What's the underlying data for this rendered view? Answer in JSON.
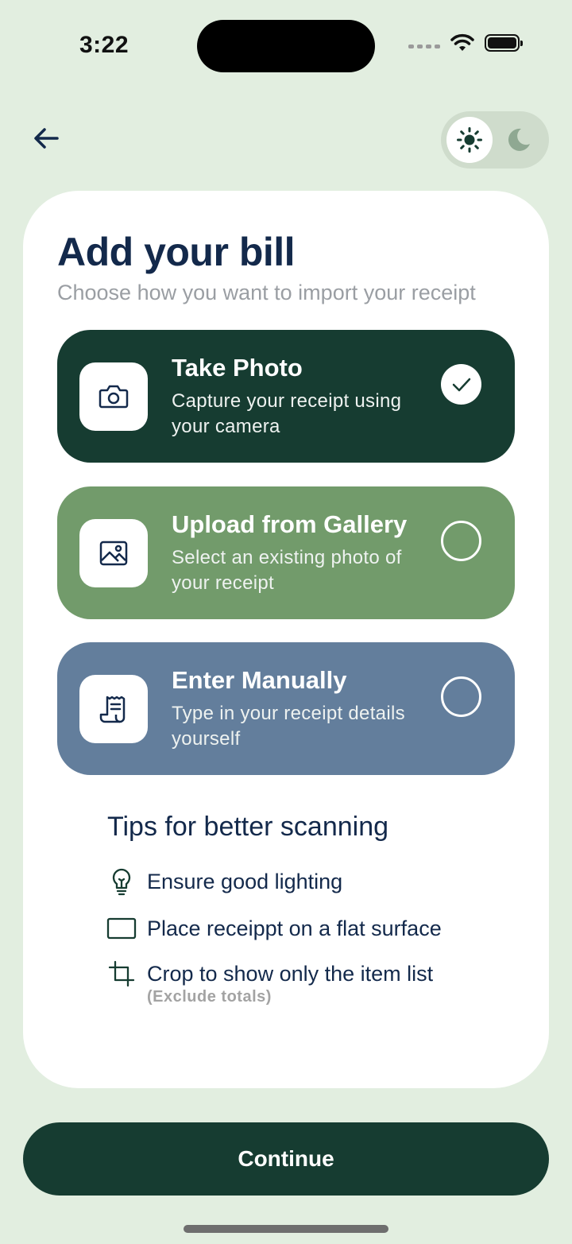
{
  "status_bar": {
    "time": "3:22"
  },
  "header": {
    "back_icon": "arrow-left-icon",
    "theme_light_icon": "sun-icon",
    "theme_dark_icon": "moon-icon"
  },
  "card": {
    "title": "Add your bill",
    "subtitle": "Choose how you want to import your receipt",
    "options": [
      {
        "title": "Take Photo",
        "description": "Capture your receipt using your camera",
        "icon": "camera-icon",
        "selected": true,
        "color": "#163c31"
      },
      {
        "title": "Upload from Gallery",
        "description": "Select an existing photo of your receipt",
        "icon": "image-icon",
        "selected": false,
        "color": "#729b6b"
      },
      {
        "title": "Enter Manually",
        "description": "Type in your receipt details yourself",
        "icon": "receipt-icon",
        "selected": false,
        "color": "#637e9c"
      }
    ],
    "tips": {
      "title": "Tips for better scanning",
      "items": [
        {
          "text": "Ensure good lighting",
          "icon": "lightbulb-icon"
        },
        {
          "text": "Place receippt on a flat surface",
          "icon": "rectangle-icon"
        },
        {
          "text": "Crop to show only the item list",
          "note": "(Exclude totals)",
          "icon": "crop-icon"
        }
      ]
    }
  },
  "footer": {
    "continue_label": "Continue"
  },
  "colors": {
    "background": "#e2eee0",
    "primary": "#163c31",
    "text": "#13294b"
  }
}
